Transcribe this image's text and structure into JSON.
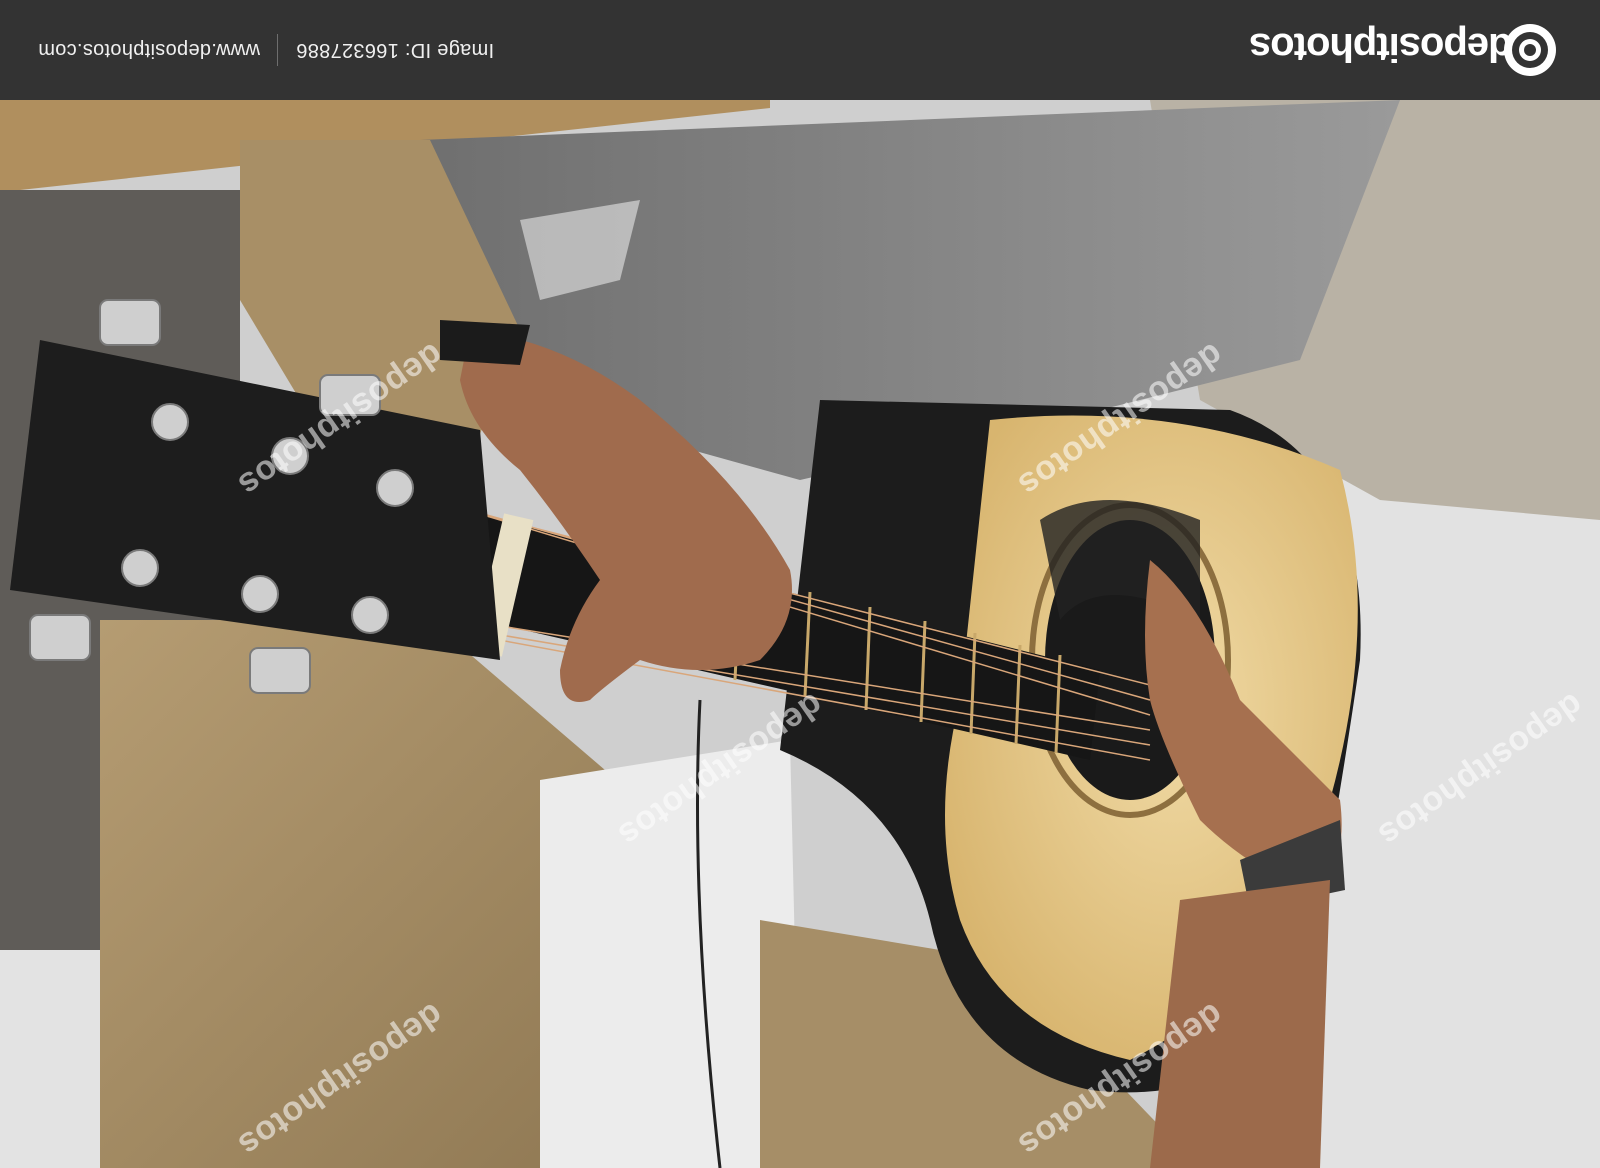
{
  "banner": {
    "url": "www.depositphotos.com",
    "image_id": "Image ID: 166327886",
    "brand": "depositphotos"
  },
  "watermark": {
    "text": "depositphotos"
  },
  "colors": {
    "banner_bg": "#333333",
    "guitar_top": "#e8c98a",
    "guitar_body_dark": "#1c1c1c",
    "jacket": "#a58c63",
    "jeans": "#8d8d8d"
  }
}
